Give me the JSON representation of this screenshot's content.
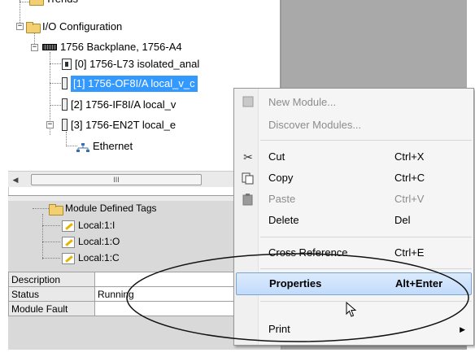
{
  "tree": {
    "partial_top": "Trends",
    "io_config": "I/O Configuration",
    "backplane": "1756 Backplane, 1756-A4",
    "modules": [
      {
        "label": "[0] 1756-L73 isolated_anal"
      },
      {
        "label": "[1] 1756-OF8I/A local_v_c"
      },
      {
        "label": "[2] 1756-IF8I/A local_v"
      },
      {
        "label": "[3] 1756-EN2T local_e"
      }
    ],
    "ethernet": "Ethernet"
  },
  "scroll": {
    "thumb_glyph": "III"
  },
  "tags": {
    "folder": "Module Defined Tags",
    "items": [
      "Local:1:I",
      "Local:1:O",
      "Local:1:C"
    ]
  },
  "props": [
    {
      "key": "Description",
      "value": ""
    },
    {
      "key": "Status",
      "value": "Running"
    },
    {
      "key": "Module Fault",
      "value": ""
    }
  ],
  "menu": {
    "items": [
      {
        "label": "New Module...",
        "shortcut": ""
      },
      {
        "label": "Discover Modules...",
        "shortcut": ""
      },
      {
        "label": "Cut",
        "shortcut": "Ctrl+X"
      },
      {
        "label": "Copy",
        "shortcut": "Ctrl+C"
      },
      {
        "label": "Paste",
        "shortcut": "Ctrl+V"
      },
      {
        "label": "Delete",
        "shortcut": "Del"
      },
      {
        "label": "Cross Reference",
        "shortcut": "Ctrl+E"
      },
      {
        "label": "Properties",
        "shortcut": "Alt+Enter"
      },
      {
        "label": "Print",
        "shortcut": ""
      }
    ]
  },
  "colors": {
    "selection": "#3399ff",
    "highlight_border": "#7da2ce",
    "folder": "#f2d072"
  }
}
